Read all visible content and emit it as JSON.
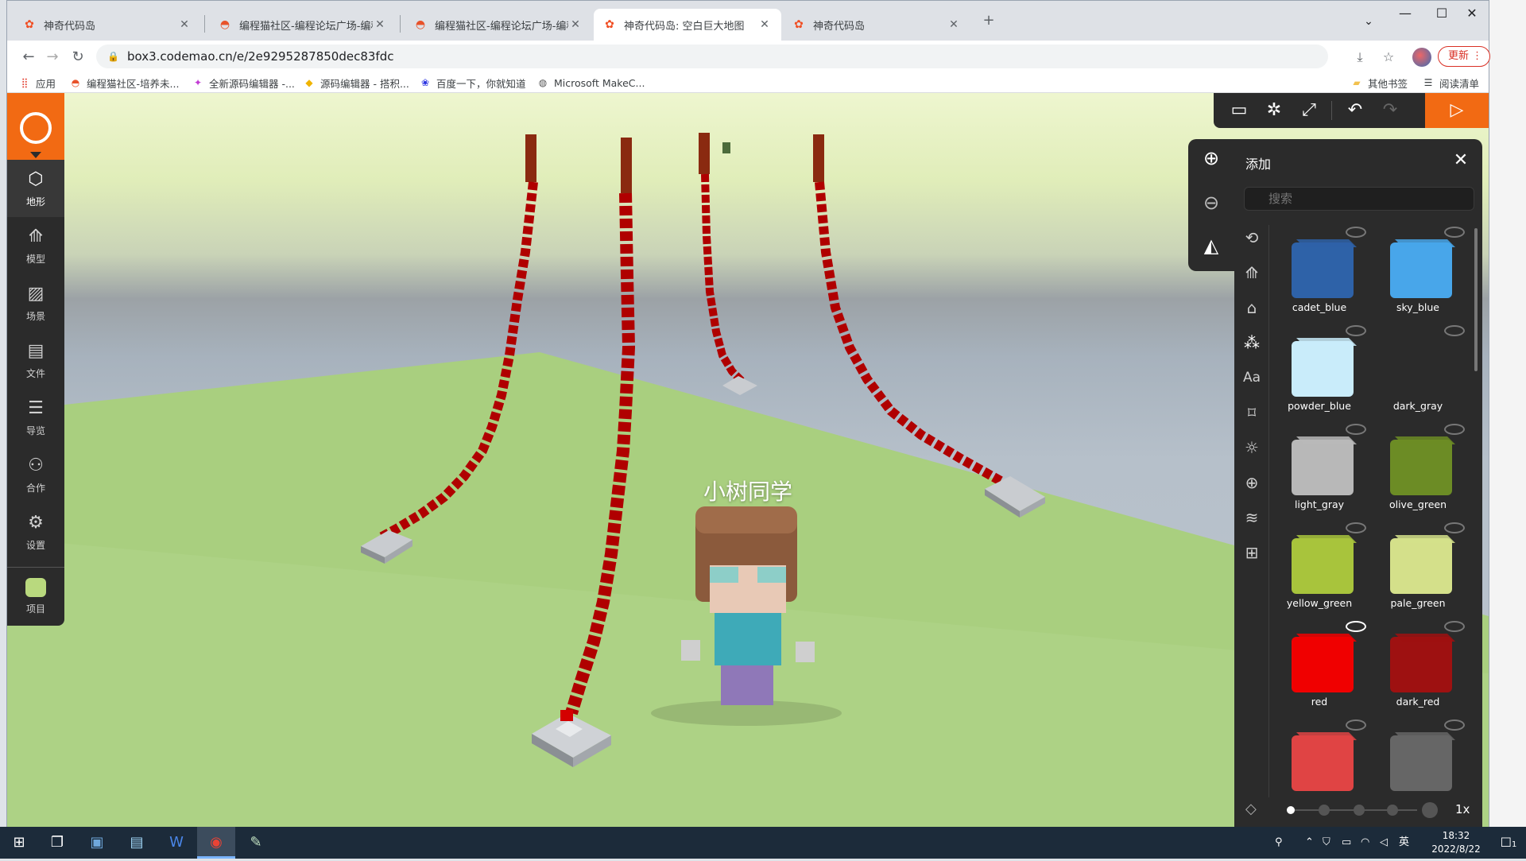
{
  "browser": {
    "tabs": [
      {
        "label": "神奇代码岛",
        "active": false
      },
      {
        "label": "编程猫社区-编程论坛广场-编程",
        "active": false
      },
      {
        "label": "编程猫社区-编程论坛广场-编程",
        "active": false
      },
      {
        "label": "神奇代码岛: 空白巨大地图",
        "active": true
      },
      {
        "label": "神奇代码岛",
        "active": false
      }
    ],
    "url": "box3.codemao.cn/e/2e9295287850dec83fdc",
    "update_label": "更新",
    "bookmarks": [
      "应用",
      "编程猫社区-培养未...",
      "全新源码编辑器 -...",
      "源码编辑器 - 搭积...",
      "百度一下，你就知道",
      "Microsoft MakeC..."
    ],
    "bookmarks_right": [
      "其他书签",
      "阅读清单"
    ]
  },
  "game": {
    "player_name": "小树同学",
    "sidebar": [
      {
        "label": "地形",
        "icon": "cube-icon",
        "active": true
      },
      {
        "label": "模型",
        "icon": "tree-icon",
        "active": false
      },
      {
        "label": "场景",
        "icon": "image-icon",
        "active": false
      },
      {
        "label": "文件",
        "icon": "file-icon",
        "active": false
      },
      {
        "label": "导览",
        "icon": "list-icon",
        "active": false
      },
      {
        "label": "合作",
        "icon": "users-icon",
        "active": false
      },
      {
        "label": "设置",
        "icon": "gear-icon",
        "active": false
      },
      {
        "label": "项目",
        "icon": "project-icon",
        "active": false
      }
    ],
    "topbar_icons": [
      "chat-icon",
      "bug-icon",
      "expand-icon",
      "undo-icon",
      "redo-icon",
      "play-icon"
    ]
  },
  "panel": {
    "title": "添加",
    "search_placeholder": "搜索",
    "categories": [
      "history-icon",
      "tree-icon",
      "house-icon",
      "color-icon",
      "text-icon",
      "tag-icon",
      "sun-icon",
      "plus-circle-icon",
      "layers-icon",
      "grid-icon"
    ],
    "blocks": [
      {
        "name": "cadet_blue",
        "color": "#2e62a8"
      },
      {
        "name": "sky_blue",
        "color": "#48a6ea"
      },
      {
        "name": "powder_blue",
        "color": "#c9ecfa"
      },
      {
        "name": "dark_gray",
        "color": ""
      },
      {
        "name": "light_gray",
        "color": "#b8b8b8"
      },
      {
        "name": "olive_green",
        "color": "#6c8c25"
      },
      {
        "name": "yellow_green",
        "color": "#a8c43c"
      },
      {
        "name": "pale_green",
        "color": "#d4e08a"
      },
      {
        "name": "red",
        "color": "#f00000"
      },
      {
        "name": "dark_red",
        "color": "#9e1111"
      },
      {
        "name": "",
        "color": "#e04444"
      },
      {
        "name": "",
        "color": "#666666"
      }
    ],
    "speed_label": "1x"
  },
  "taskbar": {
    "time": "18:32",
    "date": "2022/8/22",
    "ime": "英",
    "notifications": "1"
  }
}
